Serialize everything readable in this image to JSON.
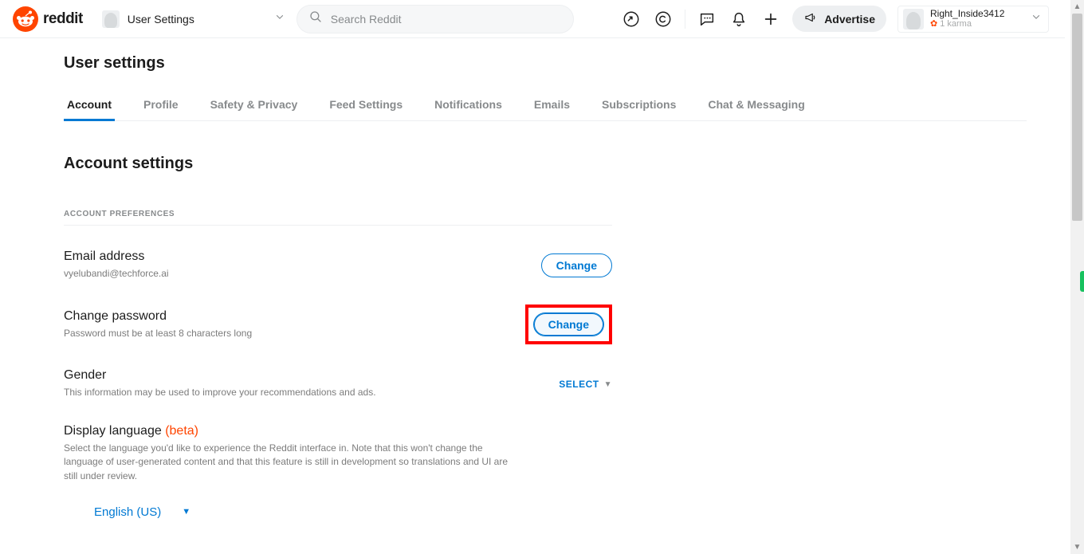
{
  "brand": "reddit",
  "nav": {
    "label": "User Settings"
  },
  "search": {
    "placeholder": "Search Reddit"
  },
  "header": {
    "advertise": "Advertise"
  },
  "user": {
    "name": "Right_Inside3412",
    "karma": "1 karma"
  },
  "page": {
    "title": "User settings",
    "section_title": "Account settings",
    "subhead": "ACCOUNT PREFERENCES"
  },
  "tabs": [
    {
      "label": "Account",
      "active": true
    },
    {
      "label": "Profile"
    },
    {
      "label": "Safety & Privacy"
    },
    {
      "label": "Feed Settings"
    },
    {
      "label": "Notifications"
    },
    {
      "label": "Emails"
    },
    {
      "label": "Subscriptions"
    },
    {
      "label": "Chat & Messaging"
    }
  ],
  "rows": {
    "email": {
      "title": "Email address",
      "value": "vyelubandi@techforce.ai",
      "button": "Change"
    },
    "password": {
      "title": "Change password",
      "sub": "Password must be at least 8 characters long",
      "button": "Change"
    },
    "gender": {
      "title": "Gender",
      "sub": "This information may be used to improve your recommendations and ads.",
      "action": "SELECT"
    },
    "language": {
      "title": "Display language ",
      "beta": "(beta)",
      "sub": "Select the language you'd like to experience the Reddit interface in. Note that this won't change the language of user-generated content and that this feature is still in development so translations and UI are still under review.",
      "value": "English (US)"
    }
  }
}
